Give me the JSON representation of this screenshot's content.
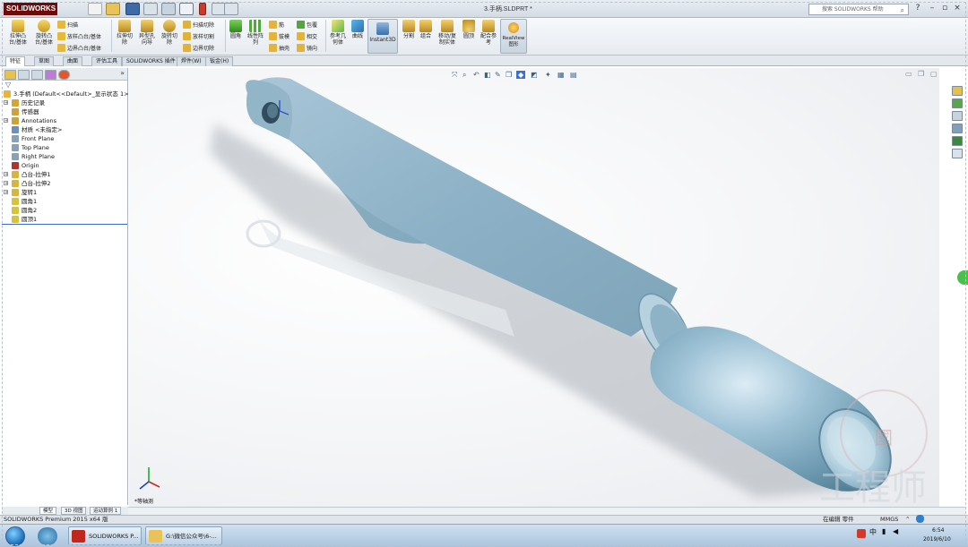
{
  "app": {
    "logo": "SOLIDWORKS",
    "document_title": "3.手柄.SLDPRT *",
    "search_placeholder": "搜索 SOLIDWORKS 帮助",
    "window_help": "?"
  },
  "ribbon": {
    "extrude_boss": "拉伸凸\n台/基体",
    "revolve_boss": "旋转凸\n台/基体",
    "sweep": "扫描",
    "loft_boss": "放样凸台/基体",
    "boundary_boss": "边界凸台/基体",
    "extrude_cut": "拉伸切\n除",
    "hole_wizard": "异型孔\n向导",
    "revolve_cut": "旋转切\n除",
    "sweep_cut": "扫描切除",
    "loft_cut": "放样切割",
    "boundary_cut": "边界切除",
    "fillet": "圆角",
    "linear_pattern": "线性阵\n列",
    "rib": "筋",
    "draft": "拔模",
    "shell": "抽壳",
    "wrap": "包覆",
    "intersect": "相交",
    "mirror": "镜向",
    "reference_geometry": "参考几\n何体",
    "curves": "曲线",
    "instant3d": "Instant3D",
    "split": "分割",
    "combine": "组合",
    "move_copy": "移动/复\n制实体",
    "dome": "圆顶",
    "reference": "配合参\n考",
    "realview": "RealView\n图形"
  },
  "cm_tabs": [
    "特征",
    "草图",
    "曲面",
    "评估工具",
    "SOLIDWORKS 插件",
    "焊件(W)",
    "钣金(H)"
  ],
  "feature_tree": {
    "root": "3.手柄 (Default<<Default>_显示状态 1>)",
    "items": [
      {
        "label": "历史记录",
        "color": "#d6a531",
        "expander": "+"
      },
      {
        "label": "传感器",
        "color": "#cfa13a",
        "expander": ""
      },
      {
        "label": "Annotations",
        "color": "#caa43b",
        "expander": "+"
      },
      {
        "label": "材质 <未指定>",
        "color": "#6d8fbf",
        "expander": ""
      },
      {
        "label": "Front Plane",
        "color": "#8aa0b6",
        "expander": ""
      },
      {
        "label": "Top Plane",
        "color": "#8aa0b6",
        "expander": ""
      },
      {
        "label": "Right Plane",
        "color": "#8aa0b6",
        "expander": ""
      },
      {
        "label": "Origin",
        "color": "#b0342c",
        "expander": ""
      },
      {
        "label": "凸台-拉伸1",
        "color": "#d8b43c",
        "expander": "+"
      },
      {
        "label": "凸台-拉伸2",
        "color": "#d8b43c",
        "expander": "+"
      },
      {
        "label": "旋转1",
        "color": "#d8b43c",
        "expander": "+"
      },
      {
        "label": "圆角1",
        "color": "#d8c23c",
        "expander": ""
      },
      {
        "label": "圆角2",
        "color": "#d8c23c",
        "expander": ""
      },
      {
        "label": "圆顶1",
        "color": "#d8c23c",
        "expander": ""
      }
    ]
  },
  "graphics": {
    "view_label": "*等轴测"
  },
  "bottom_tabs": [
    "模型",
    "3D 视图",
    "运动算例 1"
  ],
  "status": {
    "left": "SOLIDWORKS Premium 2015 x64 版",
    "editing": "在编辑 零件",
    "units": "MMGS"
  },
  "taskbar": {
    "items": [
      "SOLIDWORKS P...",
      "G:\\微信公众号\\6-..."
    ],
    "time": "6:54",
    "date": "2019/6/10",
    "lang": "中"
  },
  "watermark": {
    "text": "工程师",
    "seal": "國"
  },
  "colors": {
    "part_blue": "#8fb3c9",
    "accent": "#3b6fd1",
    "brand": "#6d0b0b"
  }
}
